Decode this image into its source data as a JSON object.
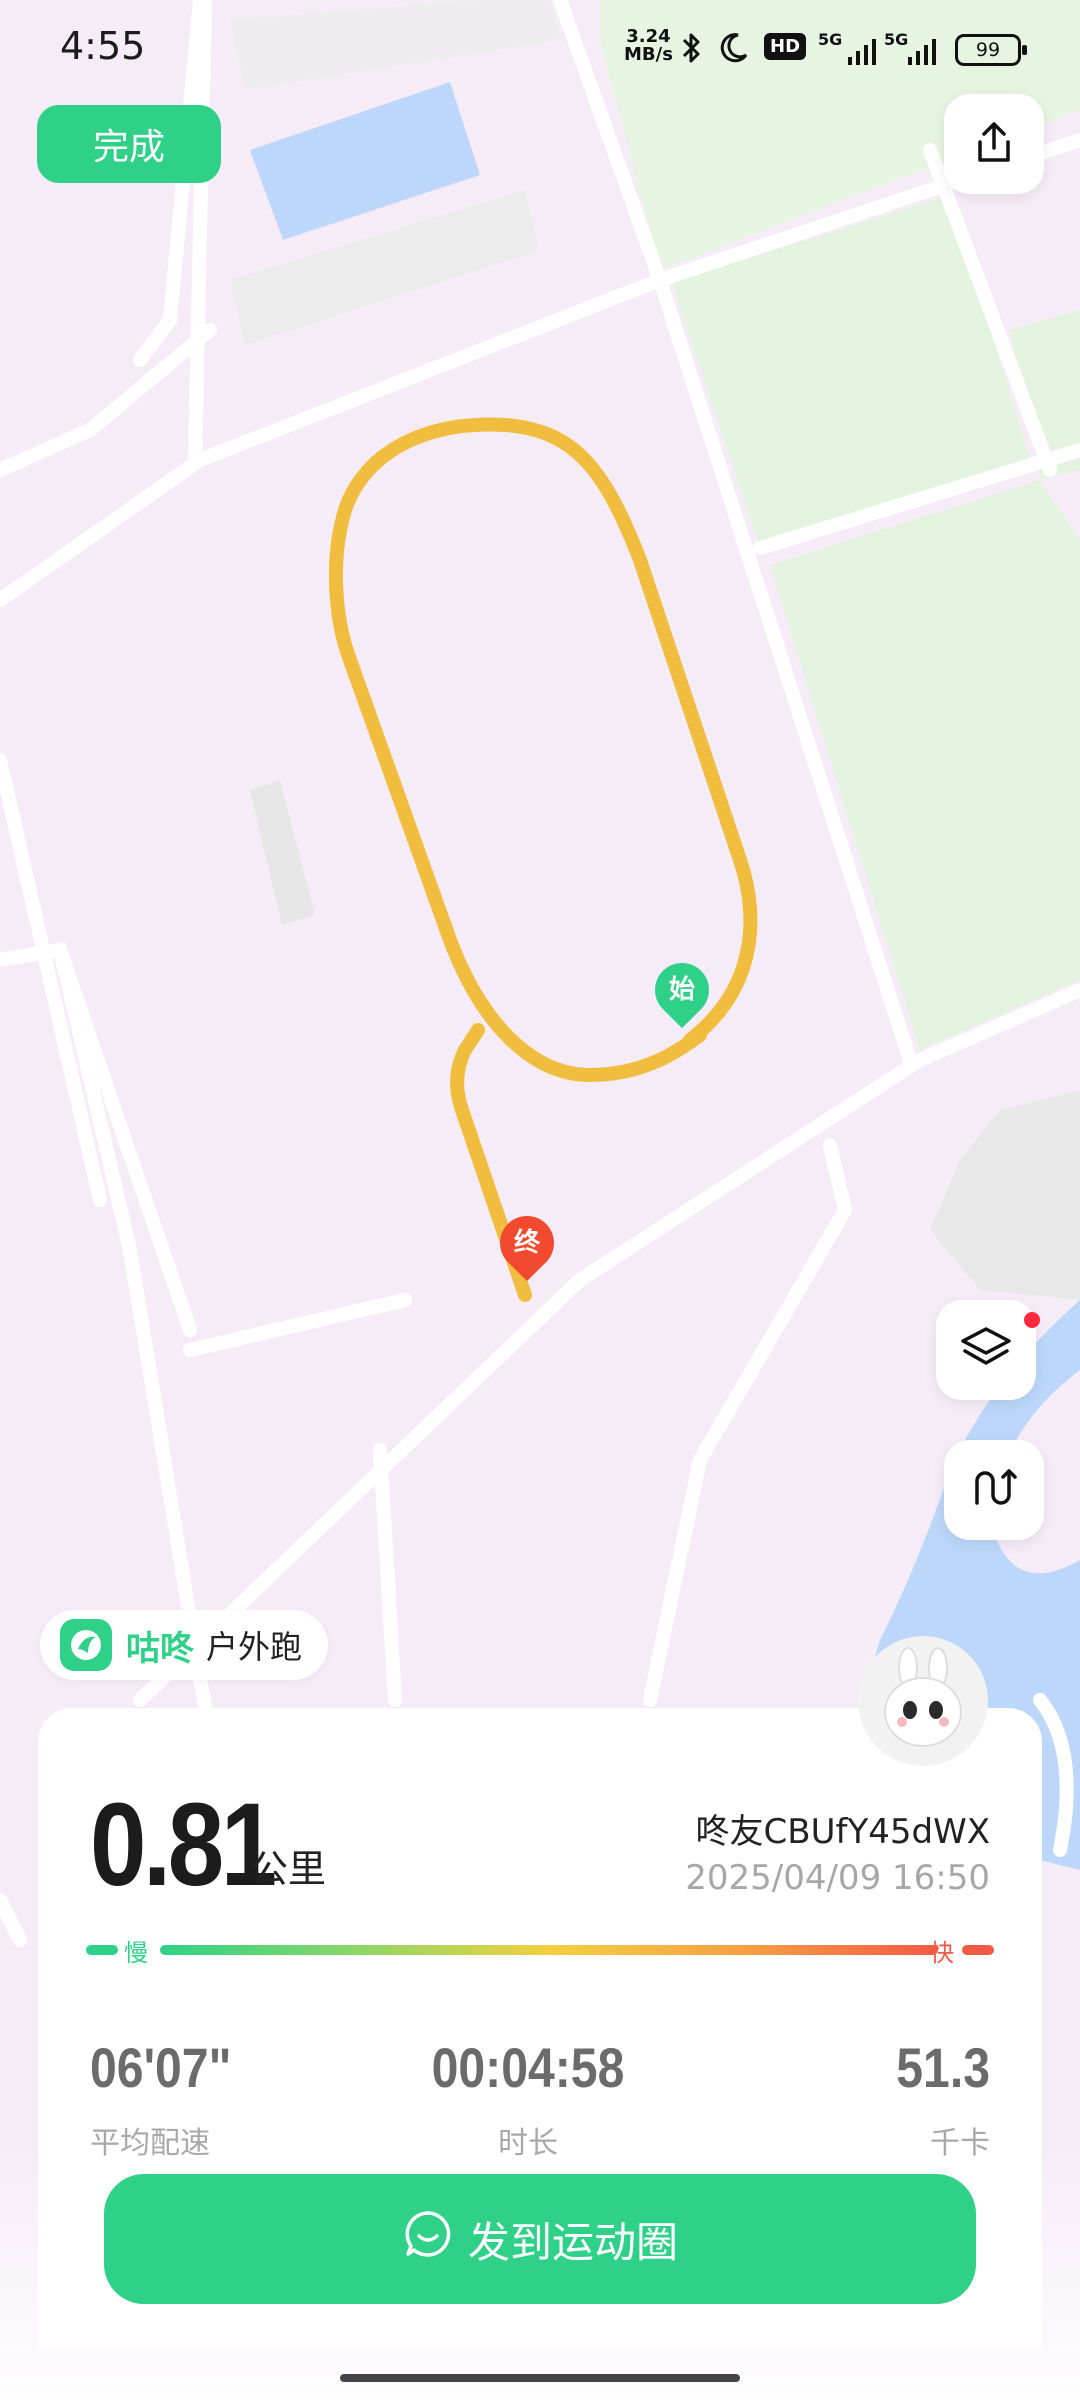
{
  "status_bar": {
    "time": "4:55",
    "net_speed_value": "3.24",
    "net_speed_unit": "MB/s",
    "hd_label": "HD",
    "signal1": "5G",
    "signal2": "5G",
    "battery": "99",
    "icons": [
      "bluetooth-icon",
      "moon-icon",
      "hd-icon",
      "signal-icon",
      "battery-icon"
    ]
  },
  "header": {
    "done_label": "完成",
    "share_icon": "share-icon"
  },
  "map": {
    "start_marker": "始",
    "end_marker": "终",
    "route_color": "#f0bd3f",
    "start_color": "#2ed187",
    "end_color": "#f24a2f",
    "controls": [
      "layers-icon",
      "route-toggle-icon"
    ]
  },
  "brand": {
    "name": "咕咚",
    "activity_type": "户外跑"
  },
  "summary": {
    "distance": "0.81",
    "distance_unit": "公里",
    "user": "咚友CBUfY45dWX",
    "datetime": "2025/04/09 16:50",
    "pace_slow": "慢",
    "pace_fast": "快",
    "stats": [
      {
        "value": "06'07\"",
        "label": "平均配速"
      },
      {
        "value": "00:04:58",
        "label": "时长"
      },
      {
        "value": "51.3",
        "label": "千卡"
      }
    ]
  },
  "actions": {
    "post_label": "发到运动圈"
  },
  "colors": {
    "accent": "#2ed187",
    "pace_fast": "#f35a45"
  }
}
